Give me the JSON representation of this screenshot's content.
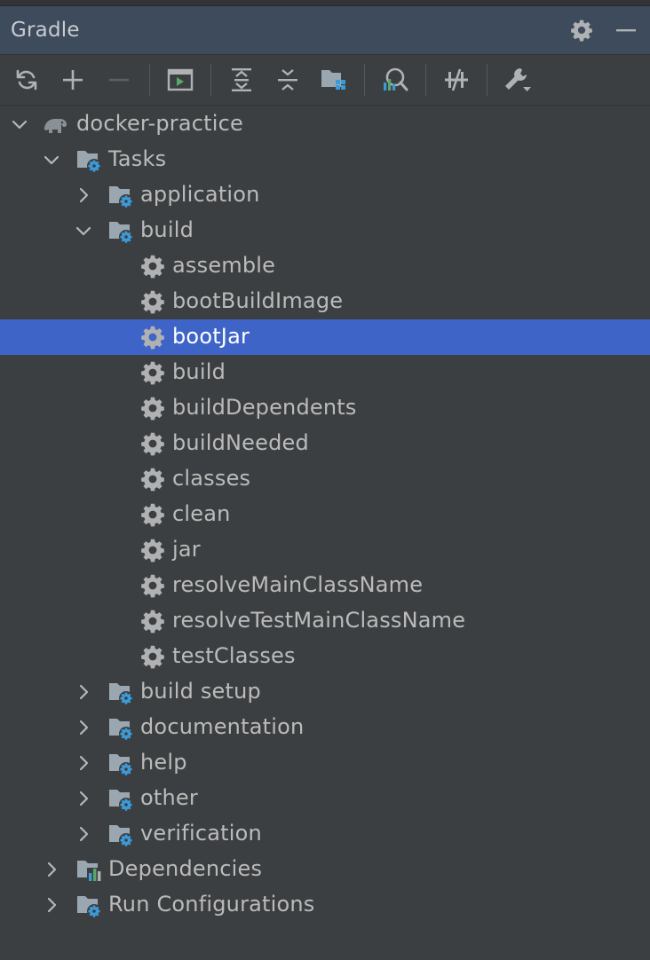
{
  "panel": {
    "title": "Gradle",
    "settings_icon": "gear-icon",
    "minimize_icon": "minus-icon"
  },
  "toolbar": {
    "items": [
      "refresh-icon",
      "plus-icon",
      "minus-icon",
      "execute-task-icon",
      "expand-all-icon",
      "collapse-all-icon",
      "show-dependencies-icon",
      "analyze-icon",
      "toggle-offline-icon",
      "build-tool-settings-icon"
    ]
  },
  "tree": {
    "root": "docker-practice",
    "tasks": "Tasks",
    "groups": {
      "application": "application",
      "build": "build",
      "build_setup": "build setup",
      "documentation": "documentation",
      "help": "help",
      "other": "other",
      "verification": "verification"
    },
    "build_tasks": [
      "assemble",
      "bootBuildImage",
      "bootJar",
      "build",
      "buildDependents",
      "buildNeeded",
      "classes",
      "clean",
      "jar",
      "resolveMainClassName",
      "resolveTestMainClassName",
      "testClasses"
    ],
    "selected_task": "bootJar",
    "dependencies": "Dependencies",
    "run_configurations": "Run Configurations"
  },
  "colors": {
    "background": "#3c3f41",
    "header": "#3d4b5c",
    "selection": "#3f64c7",
    "text": "#bbbbbb",
    "gear_badge": "#3d9ad8"
  }
}
